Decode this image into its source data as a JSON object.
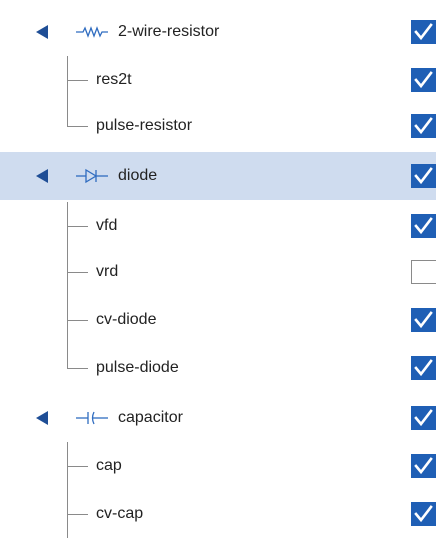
{
  "tree": {
    "nodes": [
      {
        "kind": "group",
        "label": "2-wire-resistor",
        "icon": "resistor-icon",
        "checked": true,
        "expanded": true,
        "selected": false
      },
      {
        "kind": "child",
        "label": "res2t",
        "checked": true,
        "last": false
      },
      {
        "kind": "child",
        "label": "pulse-resistor",
        "checked": true,
        "last": true
      },
      {
        "kind": "group",
        "label": "diode",
        "icon": "diode-icon",
        "checked": true,
        "expanded": true,
        "selected": true
      },
      {
        "kind": "child",
        "label": "vfd",
        "checked": true,
        "last": false
      },
      {
        "kind": "child",
        "label": "vrd",
        "checked": false,
        "last": false
      },
      {
        "kind": "child",
        "label": "cv-diode",
        "checked": true,
        "last": false
      },
      {
        "kind": "child",
        "label": "pulse-diode",
        "checked": true,
        "last": true
      },
      {
        "kind": "group",
        "label": "capacitor",
        "icon": "capacitor-icon",
        "checked": true,
        "expanded": true,
        "selected": false
      },
      {
        "kind": "child",
        "label": "cap",
        "checked": true,
        "last": false
      },
      {
        "kind": "child",
        "label": "cv-cap",
        "checked": true,
        "last": false
      }
    ]
  },
  "colors": {
    "accent": "#1f5fb5",
    "toggle": "#1f4e96",
    "selected_row": "#cfdcef",
    "tree_line": "#8a8a8a",
    "icon": "#2f6cc0"
  }
}
